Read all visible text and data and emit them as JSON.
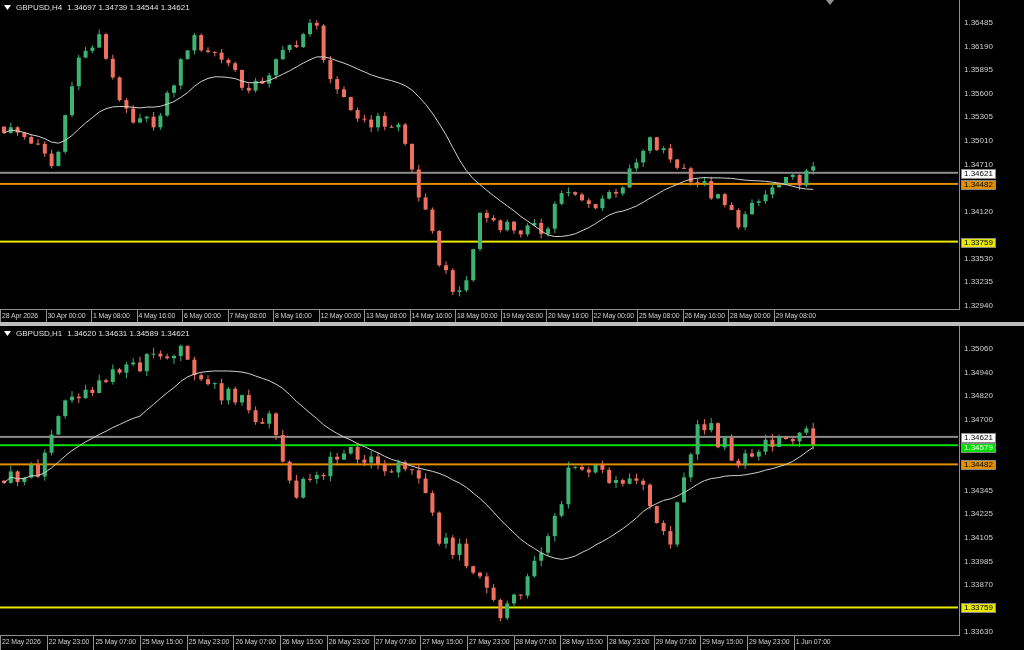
{
  "panes": [
    {
      "symbol": "GBPUSD,H4",
      "quotes": "1.34697 1.34739 1.34544 1.34621",
      "price_ticks": [
        "1.36485",
        "1.36190",
        "1.35895",
        "1.35600",
        "1.35305",
        "1.35010",
        "1.34710",
        "1.34120",
        "1.33530",
        "1.33235",
        "1.32940"
      ],
      "levels": [
        {
          "price": "1.34621",
          "color": "#8c8c8c"
        },
        {
          "price": "1.34482",
          "color": "#e09000"
        },
        {
          "price": "1.33759",
          "color": "#e8e800"
        }
      ],
      "time_labels": [
        "28 Apr 2026",
        "30 Apr 00:00",
        "1 May 08:00",
        "4 May 16:00",
        "6 May 00:00",
        "7 May 08:00",
        "8 May 16:00",
        "12 May 00:00",
        "13 May 08:00",
        "14 May 16:00",
        "18 May 00:00",
        "19 May 08:00",
        "20 May 16:00",
        "22 May 00:00",
        "25 May 08:00",
        "26 May 16:00",
        "28 May 00:00",
        "29 May 08:00"
      ]
    },
    {
      "symbol": "GBPUSD,H1",
      "quotes": "1.34620 1.34631 1.34589 1.34621",
      "price_ticks": [
        "1.35060",
        "1.34940",
        "1.34820",
        "1.34700",
        "1.34345",
        "1.34225",
        "1.34105",
        "1.33985",
        "1.33870",
        "1.33630"
      ],
      "levels": [
        {
          "price": "1.34621",
          "color": "#8c8c8c"
        },
        {
          "price": "1.34579",
          "color": "#00e000"
        },
        {
          "price": "1.34482",
          "color": "#e09000"
        },
        {
          "price": "1.33759",
          "color": "#e8e800"
        }
      ],
      "time_labels": [
        "22 May 2026",
        "22 May 23:00",
        "25 May 07:00",
        "25 May 15:00",
        "25 May 23:00",
        "26 May 07:00",
        "26 May 15:00",
        "26 May 23:00",
        "27 May 07:00",
        "27 May 15:00",
        "27 May 23:00",
        "28 May 07:00",
        "28 May 15:00",
        "28 May 23:00",
        "29 May 07:00",
        "29 May 15:00",
        "29 May 23:00",
        "1 Jun 07:00"
      ]
    }
  ]
}
